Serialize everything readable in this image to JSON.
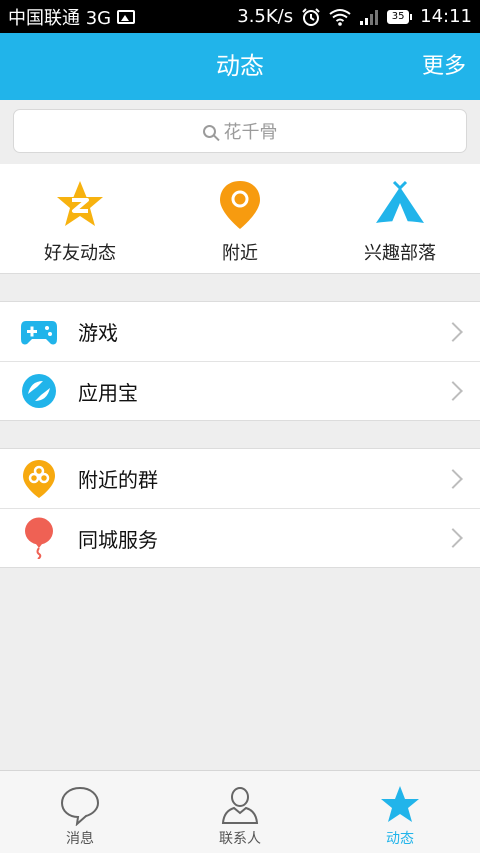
{
  "status": {
    "carrier": "中国联通 3G",
    "speed": "3.5K/s",
    "battery": "35",
    "time": "14:11"
  },
  "header": {
    "title": "动态",
    "more": "更多"
  },
  "search": {
    "placeholder": "花千骨"
  },
  "quick": [
    {
      "label": "好友动态",
      "icon": "qzone-star-icon"
    },
    {
      "label": "附近",
      "icon": "location-pin-icon"
    },
    {
      "label": "兴趣部落",
      "icon": "tent-icon"
    }
  ],
  "group1": [
    {
      "label": "游戏",
      "icon": "gamepad-icon"
    },
    {
      "label": "应用宝",
      "icon": "app-store-icon"
    }
  ],
  "group2": [
    {
      "label": "附近的群",
      "icon": "nearby-group-icon"
    },
    {
      "label": "同城服务",
      "icon": "balloon-icon"
    }
  ],
  "tabs": [
    {
      "label": "消息",
      "icon": "chat-bubble-icon"
    },
    {
      "label": "联系人",
      "icon": "contact-person-icon"
    },
    {
      "label": "动态",
      "icon": "star-icon",
      "active": true
    }
  ],
  "colors": {
    "accent": "#21b4ea",
    "orange": "#f79b0f",
    "red": "#ef6154"
  }
}
